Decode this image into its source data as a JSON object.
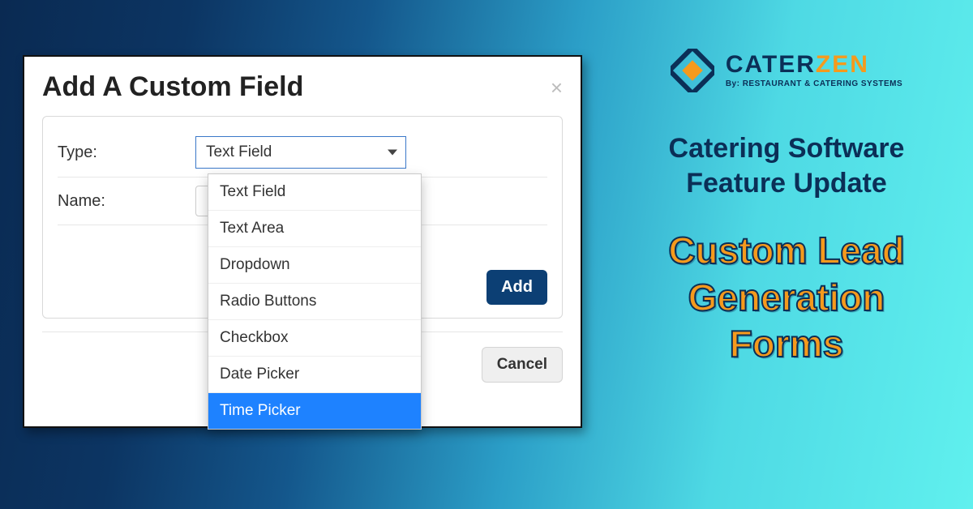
{
  "modal": {
    "title": "Add A Custom Field",
    "close_glyph": "×",
    "type_label": "Type:",
    "name_label": "Name:",
    "select_value": "Text Field",
    "add_label": "Add",
    "cancel_label": "Cancel",
    "dropdown_options": [
      "Text Field",
      "Text Area",
      "Dropdown",
      "Radio Buttons",
      "Checkbox",
      "Date Picker",
      "Time Picker"
    ],
    "highlighted_option": "Time Picker"
  },
  "brand": {
    "logo_cater": "CATER",
    "logo_zen": "ZEN",
    "byline": "By: RESTAURANT & CATERING SYSTEMS",
    "heading1_line1": "Catering Software",
    "heading1_line2": "Feature Update",
    "heading2_line1": "Custom Lead",
    "heading2_line2": "Generation",
    "heading2_line3": "Forms"
  },
  "colors": {
    "accent_orange": "#f59a1d",
    "brand_navy": "#0b2f57",
    "select_highlight": "#1e82ff"
  }
}
